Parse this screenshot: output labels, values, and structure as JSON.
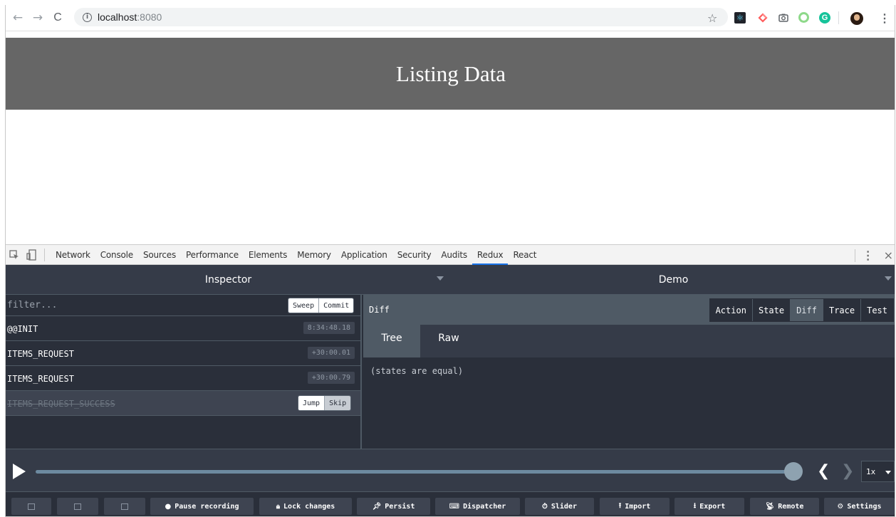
{
  "browser": {
    "back_icon": "←",
    "forward_icon": "→",
    "reload_icon": "C",
    "url_host": "localhost",
    "url_port": ":8080",
    "star_icon": "☆",
    "menu_icon": "⋮"
  },
  "page": {
    "title": "Listing Data",
    "banner_color": "#666666"
  },
  "devtools": {
    "tabs": [
      "Network",
      "Console",
      "Sources",
      "Performance",
      "Elements",
      "Memory",
      "Application",
      "Security",
      "Audits",
      "Redux",
      "React"
    ],
    "active_tab": "Redux",
    "accent": "#1a73e8",
    "kebab": "⋮",
    "close": "×"
  },
  "redux": {
    "monitor": "Inspector",
    "instance": "Demo",
    "filter_placeholder": "filter...",
    "sweep": "Sweep",
    "commit": "Commit",
    "actions": [
      {
        "name": "@@INIT",
        "time": "8:34:48.18"
      },
      {
        "name": "ITEMS_REQUEST",
        "time": "+30:00.01"
      },
      {
        "name": "ITEMS_REQUEST",
        "time": "+30:00.79"
      },
      {
        "name": "ITEMS_REQUEST_SUCCESS",
        "time": ""
      }
    ],
    "jump": "Jump",
    "skip": "Skip",
    "diff_title": "Diff",
    "tabs": [
      "Action",
      "State",
      "Diff",
      "Trace",
      "Test"
    ],
    "active_tab": "Diff",
    "subtabs": [
      "Tree",
      "Raw"
    ],
    "active_subtab": "Tree",
    "diff_body": "(states are equal)",
    "speed": "1x",
    "slider_position": 1.0,
    "toolbar": {
      "pause": "Pause recording",
      "lock": "Lock changes",
      "persist": "Persist",
      "dispatcher": "Dispatcher",
      "slider": "Slider",
      "import": "Import",
      "export": "Export",
      "remote": "Remote",
      "settings": "Settings"
    }
  }
}
